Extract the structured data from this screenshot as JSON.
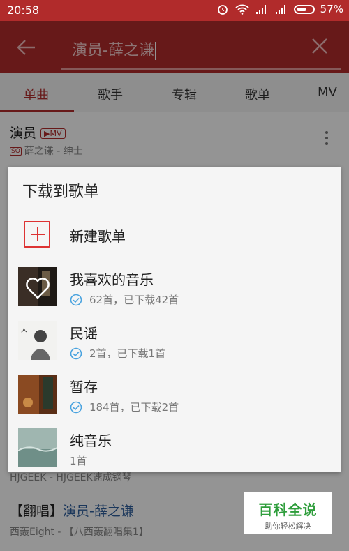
{
  "status_bar": {
    "time": "20:58",
    "battery": "57%"
  },
  "search": {
    "query": "演员-薛之谦"
  },
  "tabs": [
    "单曲",
    "歌手",
    "专辑",
    "歌单",
    "MV"
  ],
  "results": [
    {
      "title": "演员",
      "badge": "MV",
      "quality_badge": "SQ",
      "subtitle": "薛之谦 - 绅士"
    },
    {
      "subtitle": "HJGEEK - HJGEEK速成钢琴"
    },
    {
      "title_prefix": "【翻唱】",
      "title_highlight": "演员-薛之谦",
      "subtitle": "西轰Eight - 【八西轰翻唱集1】"
    }
  ],
  "dialog": {
    "title": "下载到歌单",
    "new_playlist_label": "新建歌单",
    "playlists": [
      {
        "name": "我喜欢的音乐",
        "meta": "62首，已下载42首",
        "downloaded_icon": "check-circle"
      },
      {
        "name": "民谣",
        "meta": "2首，已下载1首",
        "downloaded_icon": "check-circle"
      },
      {
        "name": "暂存",
        "meta": "184首，已下载2首",
        "downloaded_icon": "check-circle"
      },
      {
        "name": "纯音乐",
        "meta": "1首"
      }
    ]
  },
  "watermark": {
    "title": "百科全说",
    "subtitle": "助你轻松解决"
  },
  "colors": {
    "brand_red": "#b12b2b",
    "check_blue": "#4aa3df",
    "watermark_green": "#2f9e3c"
  }
}
